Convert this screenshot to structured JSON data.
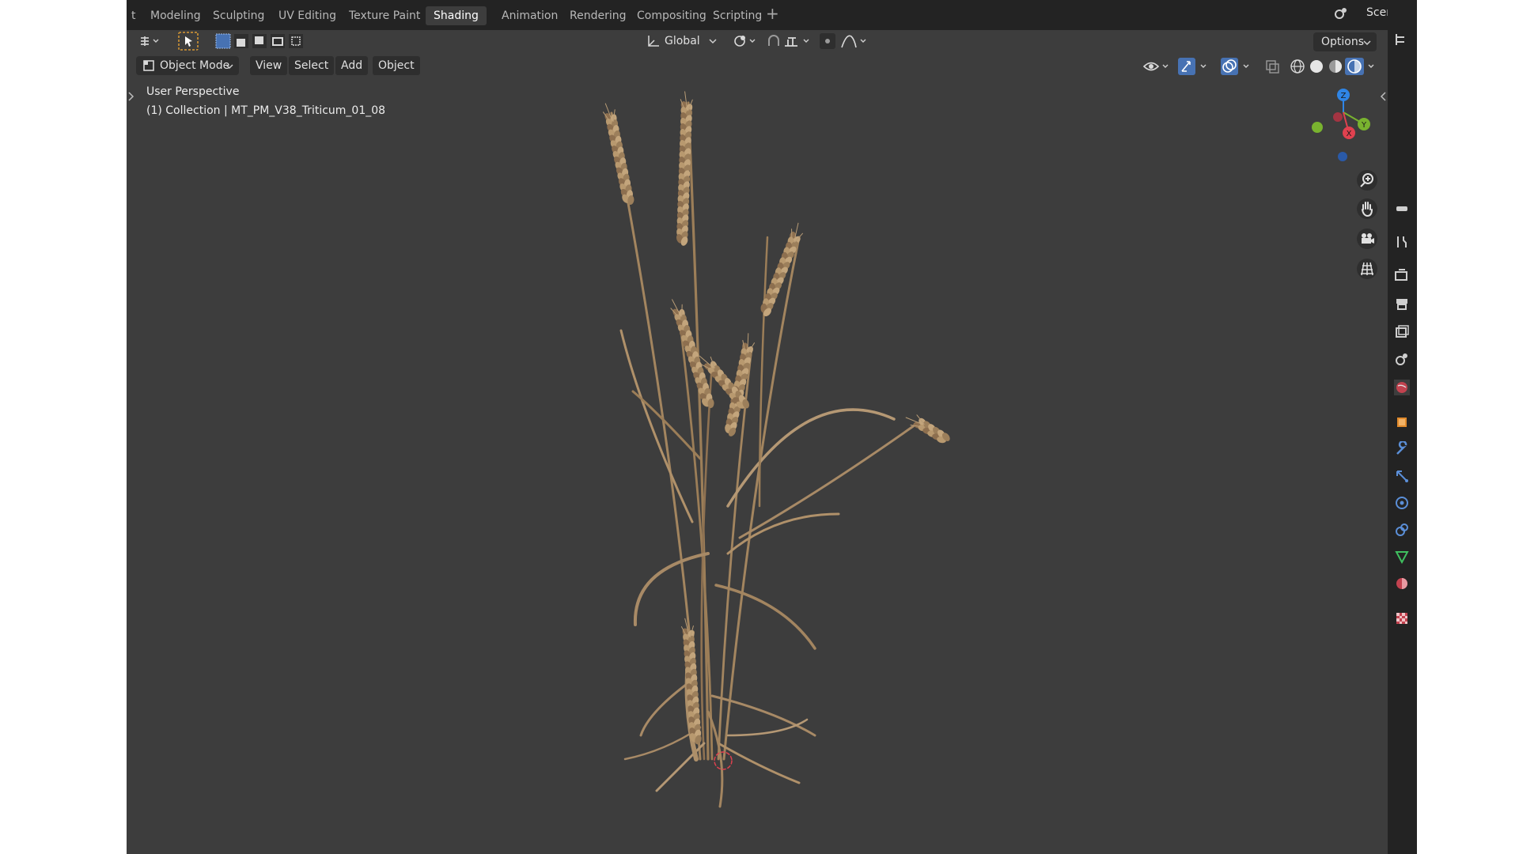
{
  "workspaces": {
    "tabs": [
      {
        "label": "t"
      },
      {
        "label": "Modeling"
      },
      {
        "label": "Sculpting"
      },
      {
        "label": "UV Editing"
      },
      {
        "label": "Texture Paint"
      },
      {
        "label": "Shading",
        "active": true
      },
      {
        "label": "Animation"
      },
      {
        "label": "Rendering"
      },
      {
        "label": "Compositing"
      },
      {
        "label": "Scripting"
      }
    ],
    "add_label": "+",
    "scene_label": "Scene"
  },
  "tool_header": {
    "orientation_label": "Global",
    "options_label": "Options"
  },
  "viewport_header": {
    "mode_label": "Object Mode",
    "menus": [
      "View",
      "Select",
      "Add",
      "Object"
    ]
  },
  "viewport": {
    "view_name": "User Perspective",
    "collection_info": "(1) Collection | MT_PM_V38_Triticum_01_08"
  },
  "gizmo": {
    "x_label": "X",
    "y_label": "Y",
    "z_label": "Z",
    "x_color": "#e0414f",
    "y_color": "#79b32f",
    "z_color": "#2f85e6"
  },
  "colors": {
    "viewport_bg": "#3d3d3d",
    "header_bg": "#232323",
    "accent_blue": "#4772b3",
    "wheat": "#a88a66"
  },
  "icons": [
    "editor-type-icon",
    "select-tool-icon",
    "select-box-icon",
    "transform-pivot-icon",
    "snap-icon",
    "proportional-edit-icon",
    "visibility-icon",
    "gizmo-icon",
    "overlay-icon",
    "xray-icon",
    "shading-wireframe-icon",
    "shading-solid-icon",
    "shading-material-icon",
    "shading-rendered-icon",
    "zoom-icon",
    "pan-hand-icon",
    "camera-icon",
    "grid-icon",
    "tool-icon",
    "render-icon",
    "output-icon",
    "view-layer-icon",
    "scene-icon",
    "world-icon",
    "object-icon",
    "modifier-icon",
    "particles-icon",
    "physics-icon",
    "constraints-icon",
    "data-icon",
    "material-icon",
    "texture-icon"
  ]
}
